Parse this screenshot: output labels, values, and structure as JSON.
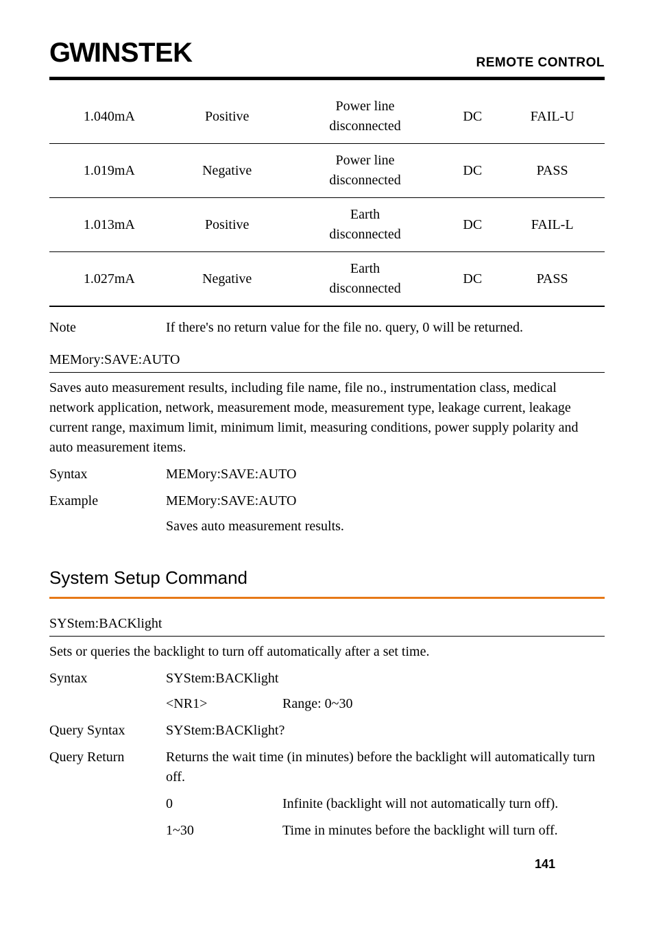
{
  "header": {
    "logo_gw": "GW",
    "logo_instek": "INSTEK",
    "title": "REMOTE CONTROL"
  },
  "table": {
    "rows": [
      {
        "c0": "1.040mA",
        "c1": "Positive",
        "c2a": "Power line",
        "c2b": "disconnected",
        "c3": "DC",
        "c4": "FAIL-U"
      },
      {
        "c0": "1.019mA",
        "c1": "Negative",
        "c2a": "Power line",
        "c2b": "disconnected",
        "c3": "DC",
        "c4": "PASS"
      },
      {
        "c0": "1.013mA",
        "c1": "Positive",
        "c2a": "Earth",
        "c2b": "disconnected",
        "c3": "DC",
        "c4": "FAIL-L"
      },
      {
        "c0": "1.027mA",
        "c1": "Negative",
        "c2a": "Earth",
        "c2b": "disconnected",
        "c3": "DC",
        "c4": "PASS"
      }
    ]
  },
  "note": {
    "label": "Note",
    "text": "If there's no return value for the file no. query, 0 will be returned."
  },
  "mem": {
    "heading": "MEMory:SAVE:AUTO",
    "desc": "Saves auto measurement results, including file name, file no., instrumentation class, medical network application, network, measurement mode, measurement type, leakage current, leakage current range, maximum limit, minimum limit, measuring conditions, power supply polarity and auto measurement items.",
    "syntax_label": "Syntax",
    "syntax_value": "MEMory:SAVE:AUTO",
    "example_label": "Example",
    "example_value": "MEMory:SAVE:AUTO",
    "example_sub": "Saves auto measurement results."
  },
  "setup": {
    "heading": "System Setup Command"
  },
  "backlight": {
    "heading": "SYStem:BACKlight",
    "desc": "Sets or queries the backlight to turn off automatically after a set time.",
    "syntax_label": "Syntax",
    "syntax_value": "SYStem:BACKlight",
    "nr1_label": "<NR1>",
    "nr1_range": "Range: 0~30",
    "qsyntax_label": "Query Syntax",
    "qsyntax_value": "SYStem:BACKlight?",
    "qreturn_label": "Query Return",
    "qreturn_desc": "Returns the wait time (in minutes) before the backlight will automatically turn off.",
    "opt0_label": "0",
    "opt0_text": "Infinite (backlight will not automatically turn off).",
    "opt1_label": "1~30",
    "opt1_text": "Time in minutes before the backlight will turn off."
  },
  "page": "141"
}
